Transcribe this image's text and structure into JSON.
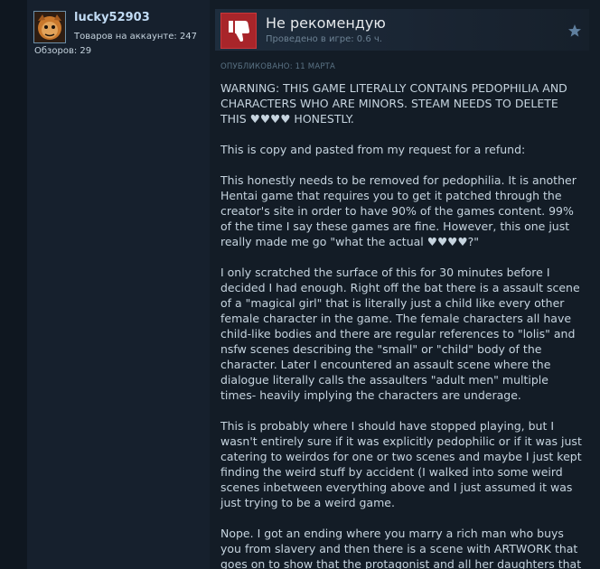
{
  "author": {
    "name": "lucky52903",
    "games_owned": "Товаров на аккаунте: 247",
    "reviews": "Обзоров: 29"
  },
  "review": {
    "verdict": "Не рекомендую",
    "playtime": "Проведено в игре: 0.6 ч.",
    "posted": "ОПУБЛИКОВАНО: 11 МАРТА",
    "paragraphs": [
      "WARNING: THIS GAME LITERALLY CONTAINS PEDOPHILIA AND CHARACTERS WHO ARE MINORS. STEAM NEEDS TO DELETE THIS ♥♥♥♥ HONESTLY.",
      "This is copy and pasted from my request for a refund:",
      "This honestly needs to be removed for pedophilia. It is another Hentai game that requires you to get it patched through the creator's site in order to have 90% of the games content. 99% of the time I say these games are fine. However, this one just really made me go \"what the actual ♥♥♥♥?\"",
      "I only scratched the surface of this for 30 minutes before I decided I had enough. Right off the bat there is a assault scene of a \"magical girl\" that is literally just a child like every other female character in the game. The female characters all have child-like bodies and there are regular references to \"lolis\" and nsfw scenes describing the \"small\" or \"child\" body of the character. Later I encountered an assault scene where the dialogue literally calls the assaulters \"adult men\" multiple times- heavily implying the characters are underage.",
      "This is probably where I should have stopped playing, but I wasn't entirely sure if it was explicitly pedophilic or if it was just catering to weirdos for one or two scenes and maybe I just kept finding the weird stuff by accident (I walked into some weird scenes inbetween everything above and I just assumed it was just trying to be a weird game.",
      "Nope. I got an ending where you marry a rich man who buys you from slavery and then there is a scene with ARTWORK that goes on to show that the protagonist and all her daughters that"
    ]
  },
  "colors": {
    "accent_link": "#c1dbf4",
    "thumb_down": "#a8252a",
    "text": "#c6d4df",
    "muted": "#6d8294"
  },
  "icons": {
    "verdict": "thumbs-down-icon",
    "favorite": "star-icon"
  }
}
